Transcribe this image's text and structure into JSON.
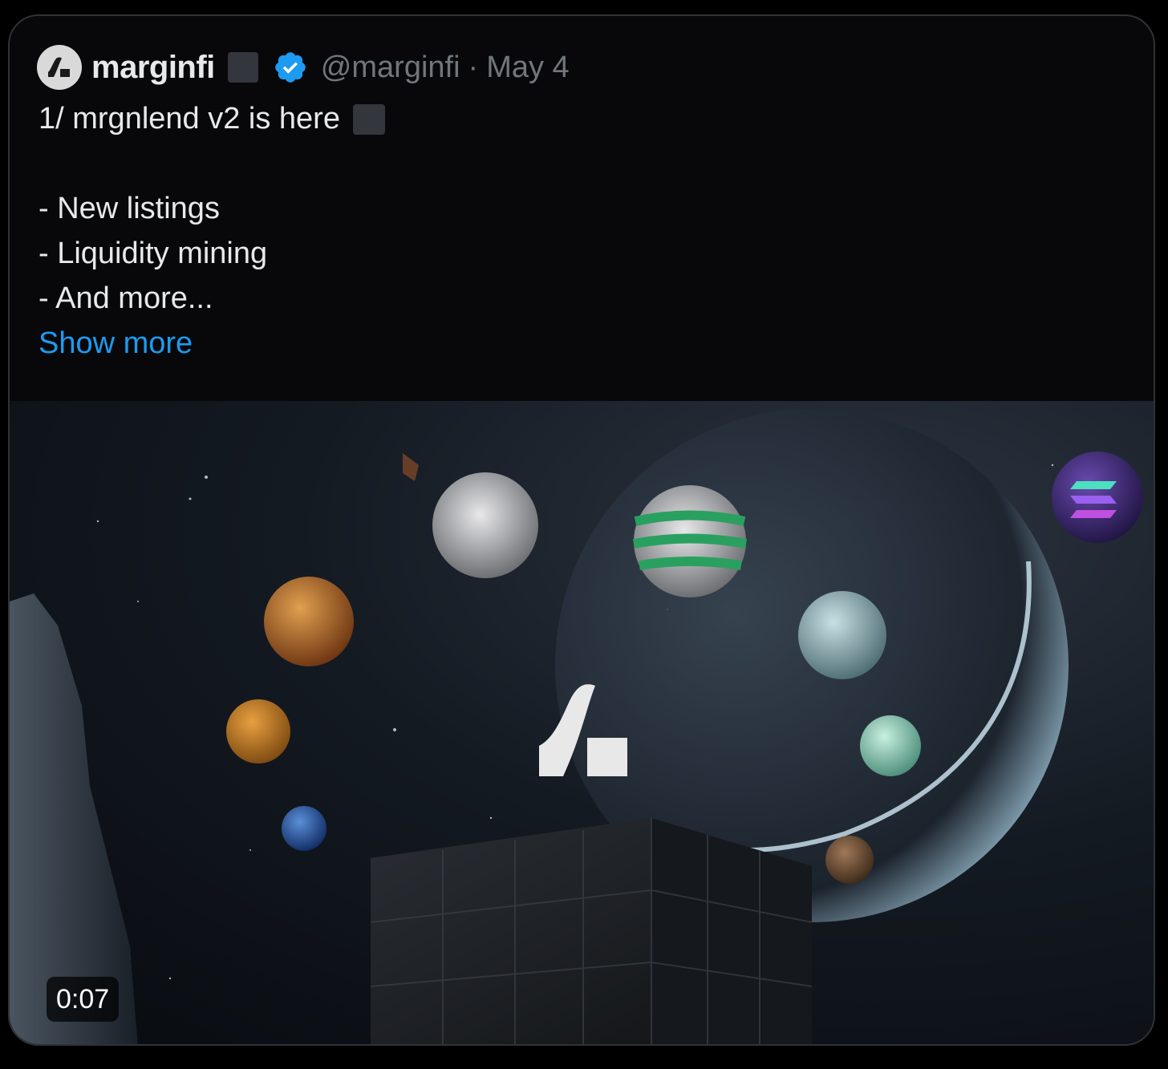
{
  "tweet": {
    "display_name": "marginfi",
    "handle": "@marginfi",
    "separator": "·",
    "date": "May 4",
    "lines": [
      "1/ mrgnlend v2 is here",
      "",
      "- New listings",
      "- Liquidity mining",
      "- And more..."
    ],
    "show_more": "Show more"
  },
  "media": {
    "type": "video",
    "duration": "0:07"
  },
  "colors": {
    "background": "#08080a",
    "text": "#e7e9ea",
    "secondary_text": "#71767b",
    "link": "#1d9bf0",
    "verified": "#1d9bf0"
  }
}
